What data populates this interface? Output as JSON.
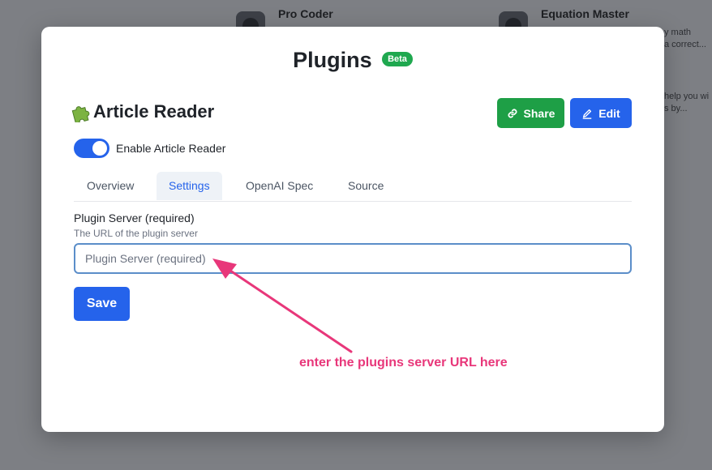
{
  "background": {
    "cards": [
      {
        "title": "Pro Coder",
        "text": ""
      },
      {
        "title": "Equation Master",
        "text_lines": [
          "y math",
          "a correct...",
          "",
          "",
          "help you wi",
          "s by..."
        ]
      }
    ]
  },
  "modal": {
    "title": "Plugins",
    "badge": "Beta",
    "plugin": {
      "icon": "puzzle-piece-icon",
      "name": "Article Reader"
    },
    "share_label": "Share",
    "edit_label": "Edit",
    "toggle": {
      "label": "Enable Article Reader",
      "checked": true
    },
    "tabs": [
      {
        "label": "Overview",
        "active": false
      },
      {
        "label": "Settings",
        "active": true
      },
      {
        "label": "OpenAI Spec",
        "active": false
      },
      {
        "label": "Source",
        "active": false
      }
    ],
    "field": {
      "label": "Plugin Server (required)",
      "help": "The URL of the plugin server",
      "placeholder": "Plugin Server (required)",
      "value": ""
    },
    "save_label": "Save"
  },
  "annotation": {
    "text": "enter the plugins server URL here"
  },
  "colors": {
    "primary": "#2563eb",
    "success": "#1e9f46",
    "badge": "#1fa84f",
    "annotation": "#e8377a"
  }
}
